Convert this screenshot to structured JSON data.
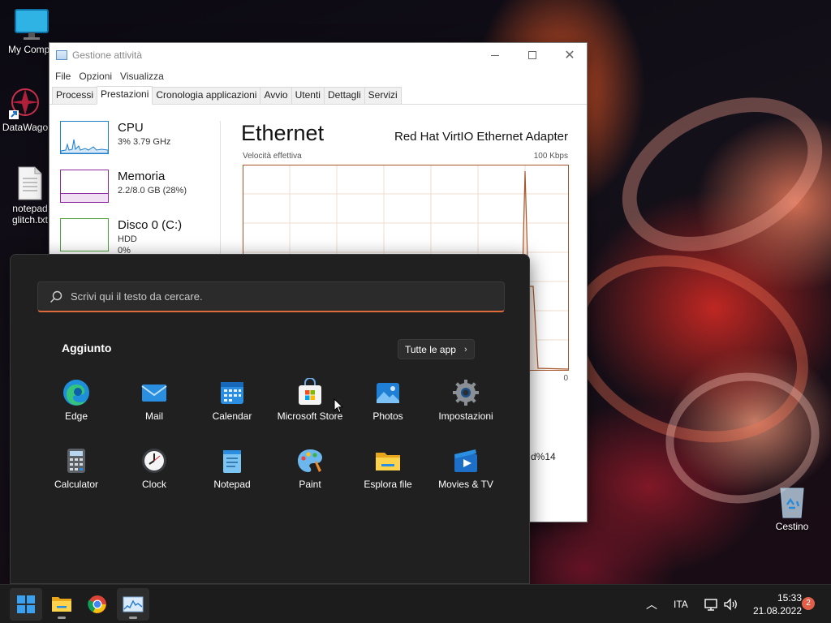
{
  "desktop": {
    "icons": [
      {
        "label": "My Compu"
      },
      {
        "label": "DataWago"
      },
      {
        "label": "notepad",
        "label2": "glitch.txt"
      },
      {
        "label": "Cestino"
      }
    ]
  },
  "task_manager": {
    "title": "Gestione attività",
    "menu": [
      "File",
      "Opzioni",
      "Visualizza"
    ],
    "tabs": [
      "Processi",
      "Prestazioni",
      "Cronologia applicazioni",
      "Avvio",
      "Utenti",
      "Dettagli",
      "Servizi"
    ],
    "active_tab": "Prestazioni",
    "perf_items": [
      {
        "name": "CPU",
        "sub": "3% 3.79 GHz",
        "color": "#1e7ec8"
      },
      {
        "name": "Memoria",
        "sub": "2.2/8.0 GB (28%)",
        "color": "#8b2a9c"
      },
      {
        "name": "Disco 0 (C:)",
        "sub": "HDD",
        "sub2": "0%",
        "color": "#4da33b"
      }
    ],
    "detail": {
      "title": "Ethernet",
      "adapter": "Red Hat VirtIO Ethernet Adapter",
      "axis_label": "Velocità effettiva",
      "axis_max": "100 Kbps",
      "axis_min": "0",
      "stat_fragment": "d%14",
      "line_color": "#a7562b"
    }
  },
  "start_menu": {
    "search_placeholder": "Scrivi qui il testo da cercare.",
    "pinned_title": "Aggiunto",
    "all_apps_label": "Tutte le app",
    "apps": [
      {
        "label": "Edge",
        "icon": "edge-icon"
      },
      {
        "label": "Mail",
        "icon": "mail-icon"
      },
      {
        "label": "Calendar",
        "icon": "calendar-icon"
      },
      {
        "label": "Microsoft Store",
        "icon": "store-icon"
      },
      {
        "label": "Photos",
        "icon": "photos-icon"
      },
      {
        "label": "Impostazioni",
        "icon": "settings-icon"
      },
      {
        "label": "Calculator",
        "icon": "calculator-icon"
      },
      {
        "label": "Clock",
        "icon": "clock-icon"
      },
      {
        "label": "Notepad",
        "icon": "notepad-icon"
      },
      {
        "label": "Paint",
        "icon": "paint-icon"
      },
      {
        "label": "Esplora file",
        "icon": "file-explorer-icon"
      },
      {
        "label": "Movies & TV",
        "icon": "movies-icon"
      }
    ]
  },
  "taskbar": {
    "pinned": [
      "start-icon",
      "file-explorer-icon",
      "chrome-icon",
      "task-manager-icon"
    ],
    "language": "ITA",
    "time": "15:33",
    "date": "21.08.2022",
    "notification_count": "2"
  }
}
